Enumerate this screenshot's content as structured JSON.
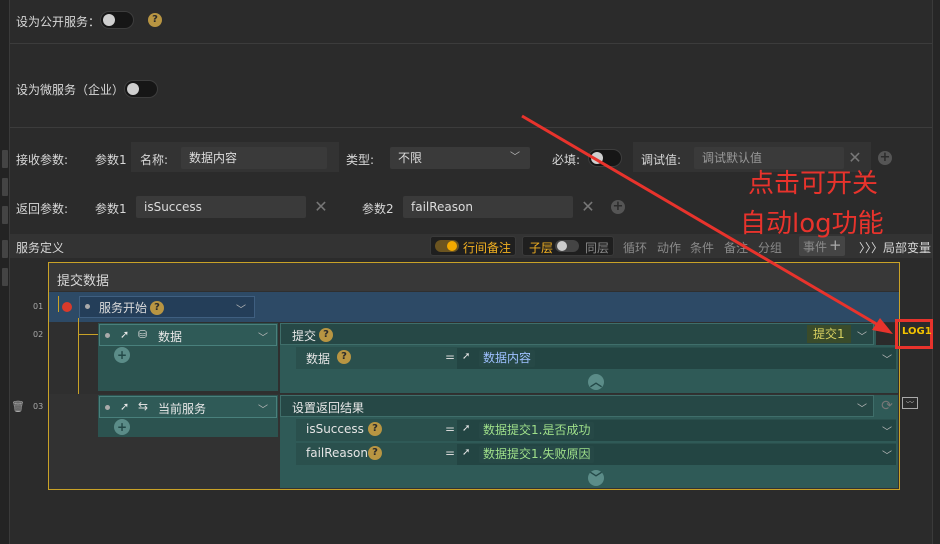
{
  "header": {
    "public_service_label": "设为公开服务：",
    "help_mark": "?",
    "micro_service_label": "设为微服务（企业）"
  },
  "receive": {
    "label": "接收参数:",
    "param_label": "参数1",
    "name_label": "名称:",
    "name_value": "数据内容",
    "type_label": "类型:",
    "type_value": "不限",
    "required_label": "必填:",
    "debug_label": "调试值:",
    "debug_placeholder": "调试默认值"
  },
  "return": {
    "label": "返回参数:",
    "param1_label": "参数1",
    "param1_value": "isSuccess",
    "param2_label": "参数2",
    "param2_value": "failReason"
  },
  "service_bar": {
    "title": "服务定义",
    "inline_note": "行间备注",
    "sublayer": "子层",
    "same_layer": "同层",
    "tabs": [
      "循环",
      "动作",
      "条件",
      "备注",
      "分组",
      "事件"
    ],
    "local_vars": "局部变量",
    "local_vars_prefix": "〉〉〉"
  },
  "flow": {
    "block_title": "提交数据",
    "rows": [
      {
        "num": "01",
        "node_label": "服务开始"
      },
      {
        "num": "02",
        "node_label": "数据",
        "action": "提交",
        "action_tag": "提交1",
        "param_name": "数据",
        "param_value": "数据内容"
      },
      {
        "num": "03",
        "node_label": "当前服务",
        "action": "设置返回结果",
        "params": [
          {
            "name": "isSuccess",
            "value": "数据提交1.是否成功"
          },
          {
            "name": "failReason",
            "value": "数据提交1.失败原因"
          }
        ]
      }
    ],
    "equals": "=",
    "log_badge": "LOG1"
  },
  "annotation": {
    "line1": "点击可开关",
    "line2": "自动log功能",
    "color": "#e8332c"
  }
}
